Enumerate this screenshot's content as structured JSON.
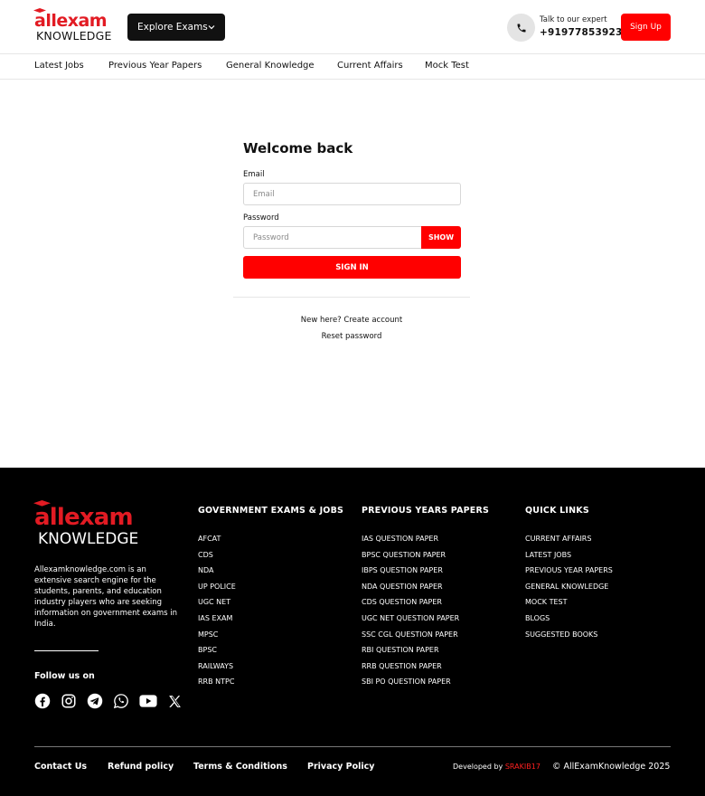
{
  "brand": {
    "line1": "allexam",
    "line2": "KNOWLEDGE",
    "accent": "#e21b23"
  },
  "header": {
    "explore_label": "Explore Exams",
    "talk_label": "Talk to our expert",
    "phone": "+919778539234",
    "signup_label": "Sign Up",
    "icons": {
      "explore": "chevron-down-icon",
      "phone": "phone-icon"
    }
  },
  "nav": {
    "items": [
      "Latest Jobs",
      "Previous Year Papers",
      "General Knowledge",
      "Current Affairs",
      "Mock Test"
    ]
  },
  "login": {
    "title": "Welcome back",
    "email_label": "Email",
    "email_placeholder": "Email",
    "email_value": "",
    "password_label": "Password",
    "password_placeholder": "Password",
    "password_value": "",
    "show_label": "SHOW",
    "signin_label": "SIGN IN",
    "create_account": "New here? Create account",
    "reset_password": "Reset password"
  },
  "footer": {
    "about": "Allexamknowledge.com is an extensive search engine for the students, parents, and education industry players who are seeking information on government exams in India.",
    "follow_label": "Follow us on",
    "socials": [
      "facebook-icon",
      "instagram-icon",
      "telegram-icon",
      "whatsapp-icon",
      "youtube-icon",
      "x-twitter-icon"
    ],
    "columns": [
      {
        "title": "GOVERNMENT EXAMS & JOBS",
        "items": [
          "AFCAT",
          "CDS",
          "NDA",
          "UP POLICE",
          "UGC NET",
          "IAS EXAM",
          "MPSC",
          "BPSC",
          "RAILWAYS",
          "RRB NTPC"
        ]
      },
      {
        "title": "PREVIOUS YEARS PAPERS",
        "items": [
          "IAS QUESTION PAPER",
          "BPSC QUESTION PAPER",
          "IBPS QUESTION PAPER",
          "NDA QUESTION PAPER",
          "CDS QUESTION PAPER",
          "UGC NET QUESTION PAPER",
          "SSC CGL QUESTION PAPER",
          "RBI QUESTION PAPER",
          "RRB QUESTION PAPER",
          "SBI PO QUESTION PAPER"
        ]
      },
      {
        "title": "QUICK LINKS",
        "items": [
          "CURRENT AFFAIRS",
          "LATEST JOBS",
          "PREVIOUS YEAR PAPERS",
          "GENERAL KNOWLEDGE",
          "MOCK TEST",
          "BLOGS",
          "SUGGESTED BOOKS"
        ]
      }
    ],
    "bottom_links": [
      "Contact Us",
      "Refund policy",
      "Terms & Conditions",
      "Privacy Policy"
    ],
    "developed_by": "Developed by",
    "developer": "SRAKIB17",
    "copyright": "© AllExamKnowledge 2025"
  },
  "colors": {
    "primary": "#ff0000",
    "dark": "#111111",
    "footer_bg": "#000000"
  }
}
